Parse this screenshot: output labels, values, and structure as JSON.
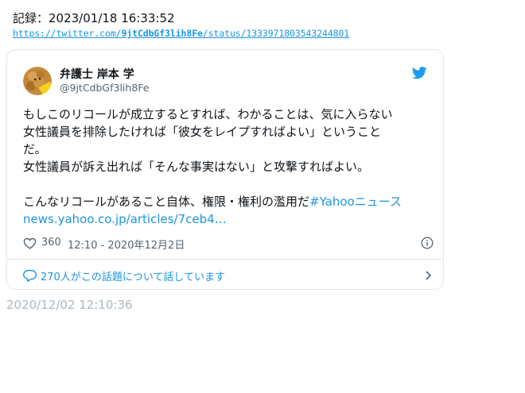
{
  "record": {
    "label": "記録：2023/01/18 16:33:52"
  },
  "url": {
    "prefix": "https://twitter.com/",
    "user": "9jtCdbGf3lih8Fe",
    "suffix": "/status/1333971803543244801"
  },
  "tweet": {
    "author_name": "弁護士 岸本 学",
    "author_handle": "@9jtCdbGf3lih8Fe",
    "lines": [
      "もしこのリコールが成立するとすれば、わかることは、気に入らない",
      "女性議員を排除したければ「彼女をレイプすればよい」ということ",
      "だ。",
      "女性議員が訴え出れば「そんな事実はない」と攻撃すればよい。"
    ],
    "last_line_text": "こんなリコールがあること自体、権限・権利の濫用だ",
    "hashtag": "#Yahooニュース",
    "link": "news.yahoo.co.jp/articles/7ceb4…",
    "like_count": "360",
    "timestamp": "12:10 - 2020年12月2日",
    "conversation": "270人がこの話題について話しています"
  },
  "capture_time": "2020/12/02 12:10:36",
  "colors": {
    "accent": "#1b95e0",
    "muted": "#536471",
    "border": "#e1e8ed",
    "faint": "#aab8c2"
  },
  "icons": {
    "logo": "twitter-bird-icon",
    "like": "heart-icon",
    "info": "info-icon",
    "reply": "speech-bubble-icon",
    "chevron": "chevron-right-icon"
  }
}
